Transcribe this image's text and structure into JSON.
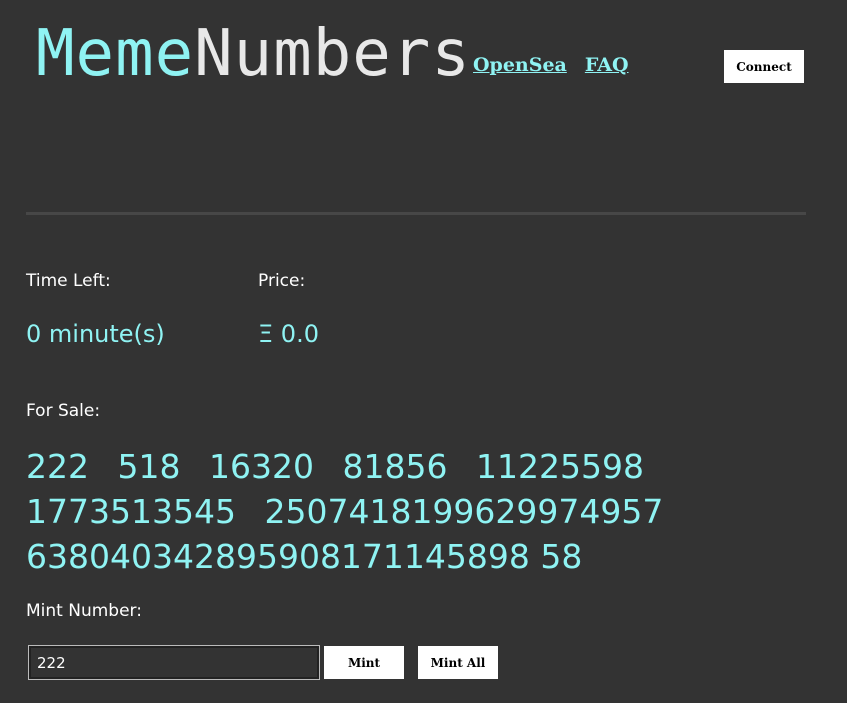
{
  "header": {
    "logo_meme": "Meme",
    "logo_numbers": "Numbers",
    "nav": [
      "OpenSea",
      "FAQ"
    ],
    "connect_label": "Connect"
  },
  "auction": {
    "time_left_label": "Time Left:",
    "time_left_value": "0 minute(s)",
    "price_label": "Price:",
    "price_value": "Ξ 0.0"
  },
  "for_sale": {
    "label": "For Sale:",
    "numbers": [
      "222",
      "518",
      "16320",
      "81856",
      "11225598",
      "1773513545",
      "2507418199629974957",
      "638040342895908171145898 58"
    ]
  },
  "mint": {
    "label": "Mint Number:",
    "input_value": "222",
    "mint_label": "Mint",
    "mint_all_label": "Mint All"
  },
  "colors": {
    "accent": "#8ff3f3",
    "background": "#333333"
  }
}
